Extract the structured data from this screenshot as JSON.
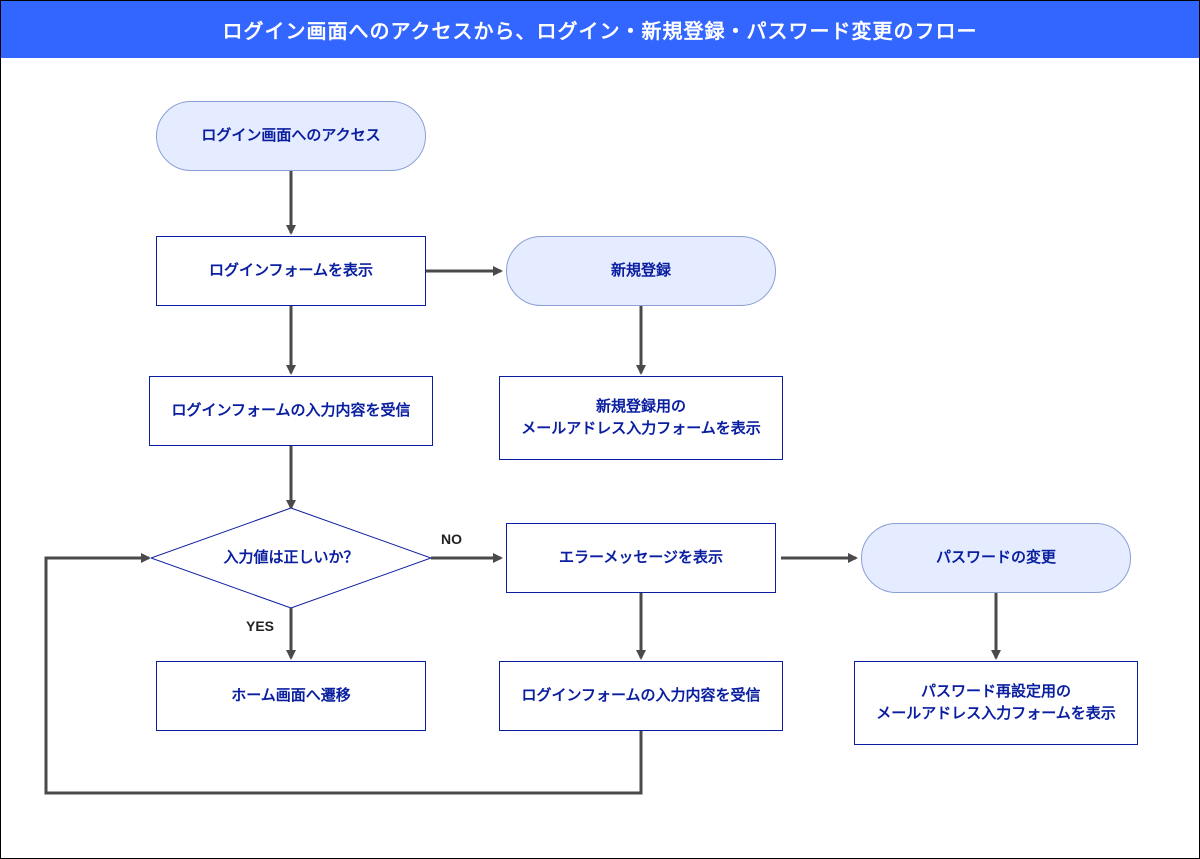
{
  "title": "ログイン画面へのアクセスから、ログイン・新規登録・パスワード変更のフロー",
  "nodes": {
    "access": "ログイン画面へのアクセス",
    "show_form": "ログインフォームを表示",
    "recv_form": "ログインフォームの入力内容を受信",
    "decision": "入力値は正しいか？",
    "home": "ホーム画面へ遷移",
    "signup": "新規登録",
    "signup_mail": "新規登録用の\nメールアドレス入力フォームを表示",
    "error": "エラーメッセージを表示",
    "recv_form2": "ログインフォームの入力内容を受信",
    "pwd": "パスワードの変更",
    "pwd_mail": "パスワード再設定用の\nメールアドレス入力フォームを表示"
  },
  "labels": {
    "yes": "YES",
    "no": "NO"
  },
  "colors": {
    "header_bg": "#3366ff",
    "node_text": "#0a1ea0",
    "terminator_fill": "#e6ecff",
    "arrow": "#4a4a4a"
  }
}
